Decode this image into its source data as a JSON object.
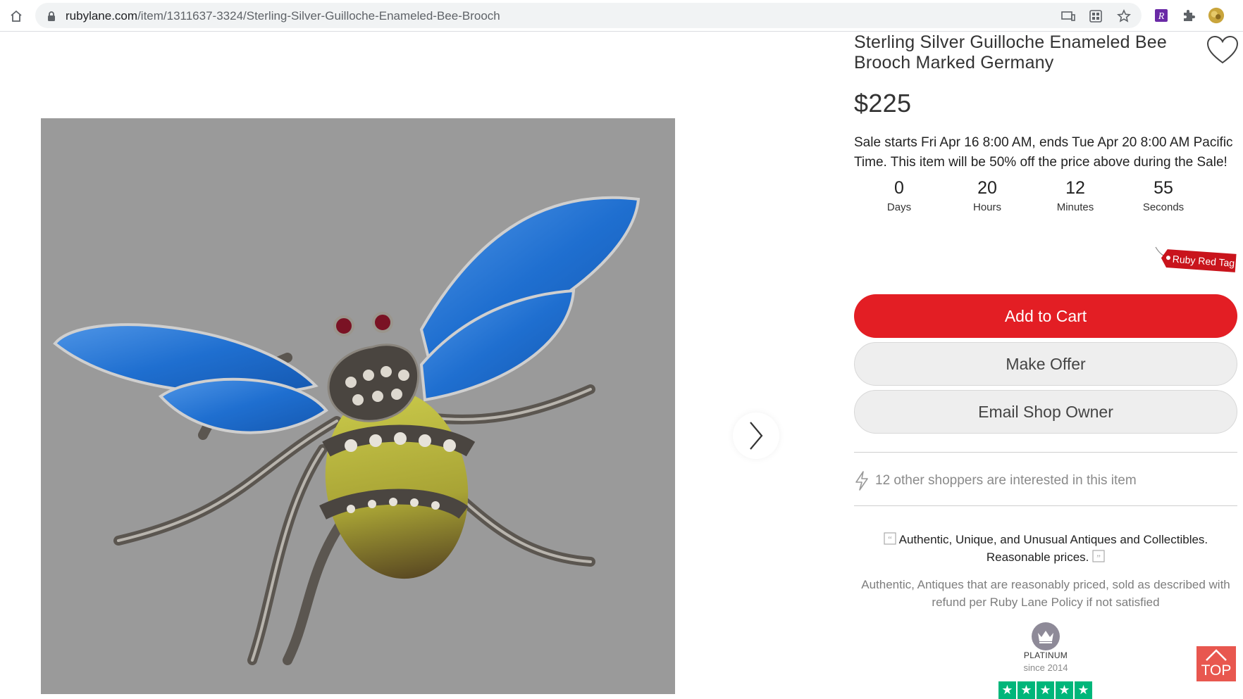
{
  "browser": {
    "url_domain": "rubylane.com",
    "url_path": "/item/1311637-3324/Sterling-Silver-Guilloche-Enameled-Bee-Brooch"
  },
  "product": {
    "title": "Sterling Silver Guilloche Enameled Bee Brooch Marked Germany",
    "price": "$225",
    "sale_text": "Sale starts Fri Apr 16 8:00 AM, ends Tue Apr 20 8:00 AM Pacific Time. This item will be 50% off the price above during the Sale!",
    "countdown": [
      {
        "value": "0",
        "label": "Days"
      },
      {
        "value": "20",
        "label": "Hours"
      },
      {
        "value": "12",
        "label": "Minutes"
      },
      {
        "value": "55",
        "label": "Seconds"
      }
    ],
    "tag_label": "Ruby Red Tag"
  },
  "actions": {
    "add_to_cart": "Add to Cart",
    "make_offer": "Make Offer",
    "email_shop_owner": "Email Shop Owner"
  },
  "interest": {
    "text": "12 other shoppers are interested in this item"
  },
  "shop": {
    "tagline": "Authentic, Unique, and Unusual Antiques and Collectibles. Reasonable prices.",
    "policy": "Authentic, Antiques that are reasonably priced, sold as described with refund per Ruby Lane Policy if not satisfied",
    "level": "PLATINUM",
    "since": "since 2014"
  },
  "scroll_top_label": "TOP",
  "colors": {
    "accent_red": "#e31e24",
    "image_bg": "#9a9a9a",
    "wing_blue": "#1f6fd0",
    "trust_green": "#00b67a"
  }
}
